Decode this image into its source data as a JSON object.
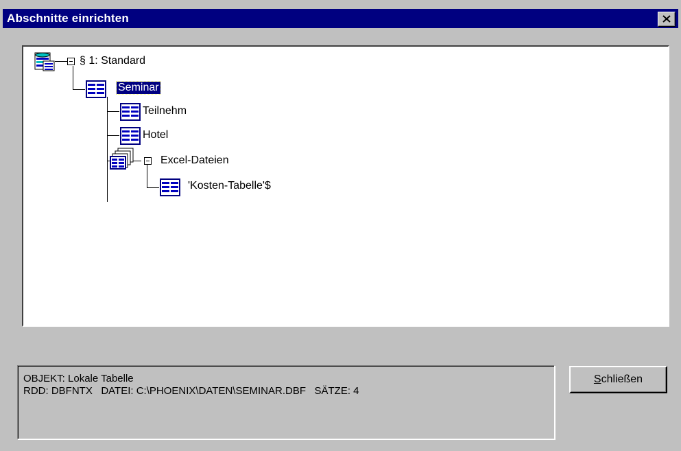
{
  "window": {
    "title": "Abschnitte einrichten"
  },
  "tree": {
    "root": {
      "label": "§ 1: Standard",
      "icon": "database-icon"
    },
    "items": [
      {
        "label": "Seminar",
        "icon": "table-icon",
        "selected": true
      },
      {
        "label": "Teilnehm",
        "icon": "table-icon"
      },
      {
        "label": "Hotel",
        "icon": "table-icon"
      },
      {
        "label": "Excel-Dateien",
        "icon": "table-stack-icon"
      },
      {
        "label": "'Kosten-Tabelle'$",
        "icon": "table-icon"
      }
    ]
  },
  "info": {
    "line1": "OBJEKT: Lokale Tabelle",
    "line2": "RDD: DBFNTX   DATEI: C:\\PHOENIX\\DATEN\\SEMINAR.DBF   SÄTZE: 4"
  },
  "buttons": {
    "close_accesskey": "S",
    "close_rest": "chließen"
  }
}
